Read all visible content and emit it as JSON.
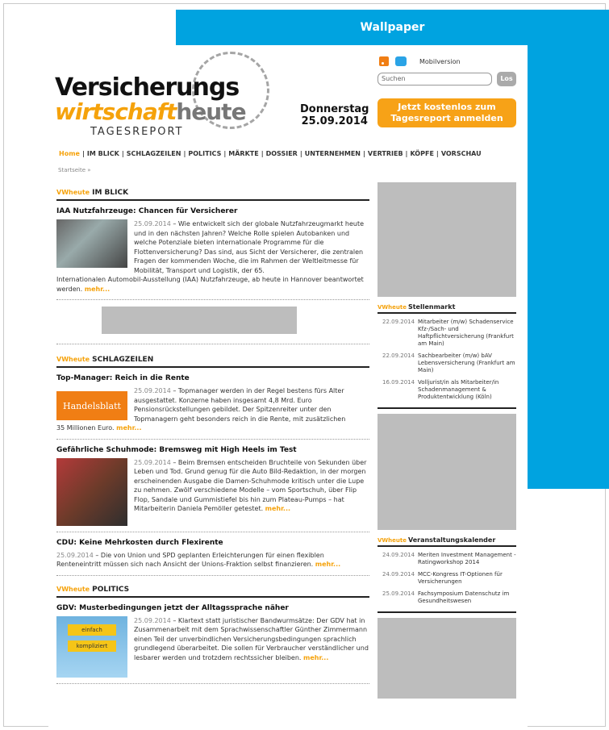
{
  "wallpaper": {
    "label": "Wallpaper"
  },
  "header": {
    "logo_line1": "Versicherungs",
    "logo_line2_a": "wirtschaft",
    "logo_line2_b": "heute",
    "logo_line3": "TAGESREPORT",
    "day": "Donnerstag",
    "date": "25.09.2014",
    "mobile_label": "Mobilversion",
    "search_placeholder": "Suchen",
    "search_button": "Los",
    "cta": "Jetzt kostenlos zum Tagesreport anmelden"
  },
  "nav": {
    "items": [
      "Home",
      "IM BLICK",
      "SCHLAGZEILEN",
      "POLITICS",
      "MÄRKTE",
      "DOSSIER",
      "UNTERNEHMEN",
      "VERTRIEB",
      "KÖPFE",
      "VORSCHAU"
    ],
    "breadcrumb": "Startseite »"
  },
  "sections": {
    "tag": "VWheute",
    "im_blick": {
      "title": "IM BLICK",
      "article": {
        "headline": "IAA Nutzfahrzeuge: Chancen für Versicherer",
        "date": "25.09.2014",
        "text": "– Wie entwickelt sich der globale Nutzfahrzeugmarkt heute und in den nächsten Jahren? Welche Rolle spielen Autobanken und welche Potenziale bieten internationale Programme für die Flottenversicherung? Das sind, aus Sicht der Versicherer, die zentralen Fragen der kommenden Woche, die im Rahmen der Weltleitmesse für Mobilität, Transport und Logistik, der 65.",
        "text2": "Internationalen Automobil-Ausstellung (IAA) Nutzfahrzeuge, ab heute in Hannover beantwortet werden.",
        "more": "mehr..."
      }
    },
    "schlagzeilen": {
      "title": "SCHLAGZEILEN",
      "articles": [
        {
          "headline": "Top-Manager: Reich in die Rente",
          "thumb_label": "Handelsblatt",
          "date": "25.09.2014",
          "text": "– Topmanager werden in der Regel bestens fürs Alter ausgestattet. Konzerne haben insgesamt 4,8 Mrd. Euro Pensionsrückstellungen gebildet. Der Spitzenreiter unter den Topmanagern geht besonders reich in die Rente, mit zusätzlichen",
          "text2": "35 Millionen Euro.",
          "more": "mehr..."
        },
        {
          "headline": "Gefährliche Schuhmode: Bremsweg mit High Heels im Test",
          "date": "25.09.2014",
          "text": "– Beim Bremsen entscheiden Bruchteile von Sekunden über Leben und Tod. Grund genug für die Auto Bild-Redaktion, in der morgen erscheinenden Ausgabe die Damen-Schuhmode kritisch unter die Lupe zu nehmen. Zwölf verschiedene Modelle – vom Sportschuh, über Flip Flop, Sandale und Gummistiefel bis hin zum Plateau-Pumps – hat Mitarbeiterin Daniela Pemöller getestet.",
          "more": "mehr..."
        },
        {
          "headline": "CDU: Keine Mehrkosten durch Flexirente",
          "date": "25.09.2014",
          "text": "– Die von Union und SPD geplanten Erleichterungen für einen flexiblen Renteneintritt müssen sich nach Ansicht der Unions-Fraktion selbst finanzieren.",
          "more": "mehr..."
        }
      ]
    },
    "politics": {
      "title": "POLITICS",
      "article": {
        "headline": "GDV: Musterbedingungen jetzt der Alltagssprache näher",
        "sign_a": "einfach",
        "sign_b": "kompliziert",
        "date": "25.09.2014",
        "text": "– Klartext statt juristischer Bandwurmsätze: Der GDV hat in Zusammenarbeit mit dem Sprachwissenschaftler Günther Zimmermann einen Teil der unverbindlichen Versicherungsbedingungen sprachlich grundlegend überarbeitet. Die sollen für Verbraucher verständlicher und lesbarer werden und trotzdem rechtssicher bleiben.",
        "more": "mehr..."
      }
    }
  },
  "sidebar": {
    "stellenmarkt": {
      "title": "Stellenmarkt",
      "items": [
        {
          "date": "22.09.2014",
          "text": "Mitarbeiter (m/w) Schadenservice Kfz-/Sach- und Haftpflichtversicherung (Frankfurt am Main)"
        },
        {
          "date": "22.09.2014",
          "text": "Sachbearbeiter (m/w) bAV Lebensversicherung (Frankfurt am Main)"
        },
        {
          "date": "16.09.2014",
          "text": "Volljurist/in als Mitarbeiter/in Schadenmanagement & Produktentwicklung (Köln)"
        }
      ]
    },
    "veranstaltungen": {
      "title": "Veranstaltungskalender",
      "items": [
        {
          "date": "24.09.2014",
          "text": "Meriten Investment Management - Ratingworkshop 2014"
        },
        {
          "date": "24.09.2014",
          "text": "MCC-Kongress IT-Optionen für Versicherungen"
        },
        {
          "date": "25.09.2014",
          "text": "Fachsymposium Datenschutz im Gesundheitswesen"
        }
      ]
    }
  }
}
